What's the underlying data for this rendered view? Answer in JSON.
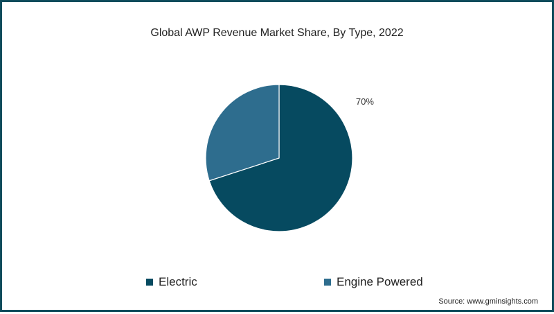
{
  "chart_data": {
    "type": "pie",
    "title": "Global AWP Revenue Market Share, By Type, 2022",
    "categories": [
      "Electric",
      "Engine Powered"
    ],
    "values": [
      70,
      30
    ],
    "colors": [
      "#064a60",
      "#2e6d8e"
    ],
    "data_labels": [
      "70%",
      ""
    ],
    "legend_position": "bottom"
  },
  "source": "Source: www.gminsights.com"
}
